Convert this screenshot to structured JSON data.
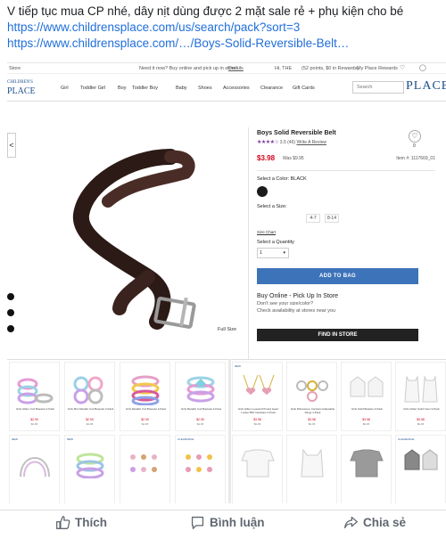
{
  "post": {
    "text": "V tiếp tục mua CP nhé, dây nịt dùng được 2 mặt sale rẻ + phụ kiện cho bé",
    "link1": "https://www.childrensplace.com/us/search/pack?sort=3",
    "link2": "https://www.childrensplace.com/…/Boys-Solid-Reversible-Belt…"
  },
  "site": {
    "top_left": "Store",
    "promo": "Need it now? Buy online and pick up in store!",
    "promo_link": "Details",
    "greeting": "Hi, THE",
    "points": "(52 points, $0 in Rewards)",
    "my_place": "My Place Rewards",
    "logo_small": "CHILDREN'S",
    "logo_big": "PLACE",
    "brand": "PLACE",
    "nav": [
      "Girl",
      "Toddler Girl",
      "Boy",
      "Toddler Boy",
      "Baby",
      "Shoes",
      "Accessories",
      "Clearance",
      "Gift Cards"
    ],
    "search_placeholder": "Search"
  },
  "product": {
    "title": "Boys Solid Reversible Belt",
    "rating": "3.5",
    "reviews": "(46)",
    "write_review": "Write A Review",
    "price": "$3.98",
    "was": "Was $9.95",
    "item": "Item #: 1117669_01",
    "color_label": "Select a Color: BLACK",
    "size_label": "Select a Size:",
    "sizes": [
      "4-7",
      "8-14"
    ],
    "size_chart": "Size Chart",
    "qty_label": "Select a Quantity",
    "qty_value": "1",
    "add_to_bag": "ADD TO BAG",
    "pickup_title": "Buy Online - Pick Up In Store",
    "pickup_sub1": "Don't see your size/color?",
    "pickup_sub2": "Check availability at stores near you",
    "find_store": "FIND IN STORE",
    "full_size": "Full Size",
    "fav_count": "0",
    "left_arrow": "<"
  },
  "grid_left": [
    {
      "tag": "",
      "name": "Girls Glitter Coil Bracelet 4-Pack",
      "price": "$2.99",
      "was": "$4.95"
    },
    {
      "tag": "",
      "name": "Girls Mini Metallic Coil Bracelet 4-Pack",
      "price": "$2.99",
      "was": "$4.95"
    },
    {
      "tag": "",
      "name": "Girls Metallic Coil Bracelet 4-Pack",
      "price": "$2.99",
      "was": "$4.95"
    },
    {
      "tag": "",
      "name": "Girls Metallic Coil Bracelet 4-Pack",
      "price": "$2.99",
      "was": "$4.95"
    },
    {
      "tag": "NEW",
      "name": "",
      "price": "",
      "was": ""
    },
    {
      "tag": "NEW",
      "name": "",
      "price": "",
      "was": ""
    },
    {
      "tag": "",
      "name": "",
      "price": "",
      "was": ""
    },
    {
      "tag": "CLEARANCE",
      "name": "",
      "price": "",
      "was": ""
    }
  ],
  "grid_right": [
    {
      "tag": "NEW",
      "name": "Girls Glitter Leopard Printed Heart Locket BFF Necklace 2-Pack",
      "price": "$3.98",
      "was": "$9.95"
    },
    {
      "tag": "",
      "name": "Girls Rhinestone Cat Ears Adjustable Rings 4-Pack",
      "price": "$3.98",
      "was": "$9.95"
    },
    {
      "tag": "",
      "name": "Girls Solid Bralette 3-Pack",
      "price": "$3.98",
      "was": "$9.95"
    },
    {
      "tag": "",
      "name": "Girls Glitter Solid Cami 3-Pack",
      "price": "$3.98",
      "was": "$9.95"
    },
    {
      "tag": "",
      "name": "",
      "price": "",
      "was": ""
    },
    {
      "tag": "",
      "name": "",
      "price": "",
      "was": ""
    },
    {
      "tag": "",
      "name": "",
      "price": "",
      "was": ""
    },
    {
      "tag": "CLEARANCE",
      "name": "",
      "price": "",
      "was": ""
    }
  ],
  "actions": {
    "like": "Thích",
    "comment": "Bình luận",
    "share": "Chia sẻ"
  },
  "colors": {
    "link": "#216fdb",
    "accent_blue": "#3d73b9",
    "price_red": "#d0021b"
  }
}
